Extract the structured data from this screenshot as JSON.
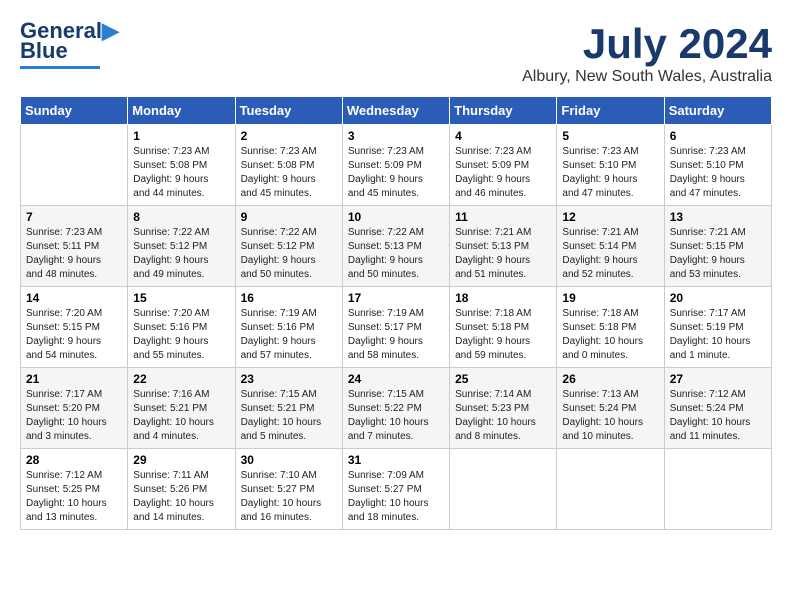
{
  "logo": {
    "line1": "General",
    "line2": "Blue"
  },
  "title": "July 2024",
  "subtitle": "Albury, New South Wales, Australia",
  "days_of_week": [
    "Sunday",
    "Monday",
    "Tuesday",
    "Wednesday",
    "Thursday",
    "Friday",
    "Saturday"
  ],
  "weeks": [
    [
      {
        "num": "",
        "info": ""
      },
      {
        "num": "1",
        "info": "Sunrise: 7:23 AM\nSunset: 5:08 PM\nDaylight: 9 hours\nand 44 minutes."
      },
      {
        "num": "2",
        "info": "Sunrise: 7:23 AM\nSunset: 5:08 PM\nDaylight: 9 hours\nand 45 minutes."
      },
      {
        "num": "3",
        "info": "Sunrise: 7:23 AM\nSunset: 5:09 PM\nDaylight: 9 hours\nand 45 minutes."
      },
      {
        "num": "4",
        "info": "Sunrise: 7:23 AM\nSunset: 5:09 PM\nDaylight: 9 hours\nand 46 minutes."
      },
      {
        "num": "5",
        "info": "Sunrise: 7:23 AM\nSunset: 5:10 PM\nDaylight: 9 hours\nand 47 minutes."
      },
      {
        "num": "6",
        "info": "Sunrise: 7:23 AM\nSunset: 5:10 PM\nDaylight: 9 hours\nand 47 minutes."
      }
    ],
    [
      {
        "num": "7",
        "info": "Sunrise: 7:23 AM\nSunset: 5:11 PM\nDaylight: 9 hours\nand 48 minutes."
      },
      {
        "num": "8",
        "info": "Sunrise: 7:22 AM\nSunset: 5:12 PM\nDaylight: 9 hours\nand 49 minutes."
      },
      {
        "num": "9",
        "info": "Sunrise: 7:22 AM\nSunset: 5:12 PM\nDaylight: 9 hours\nand 50 minutes."
      },
      {
        "num": "10",
        "info": "Sunrise: 7:22 AM\nSunset: 5:13 PM\nDaylight: 9 hours\nand 50 minutes."
      },
      {
        "num": "11",
        "info": "Sunrise: 7:21 AM\nSunset: 5:13 PM\nDaylight: 9 hours\nand 51 minutes."
      },
      {
        "num": "12",
        "info": "Sunrise: 7:21 AM\nSunset: 5:14 PM\nDaylight: 9 hours\nand 52 minutes."
      },
      {
        "num": "13",
        "info": "Sunrise: 7:21 AM\nSunset: 5:15 PM\nDaylight: 9 hours\nand 53 minutes."
      }
    ],
    [
      {
        "num": "14",
        "info": "Sunrise: 7:20 AM\nSunset: 5:15 PM\nDaylight: 9 hours\nand 54 minutes."
      },
      {
        "num": "15",
        "info": "Sunrise: 7:20 AM\nSunset: 5:16 PM\nDaylight: 9 hours\nand 55 minutes."
      },
      {
        "num": "16",
        "info": "Sunrise: 7:19 AM\nSunset: 5:16 PM\nDaylight: 9 hours\nand 57 minutes."
      },
      {
        "num": "17",
        "info": "Sunrise: 7:19 AM\nSunset: 5:17 PM\nDaylight: 9 hours\nand 58 minutes."
      },
      {
        "num": "18",
        "info": "Sunrise: 7:18 AM\nSunset: 5:18 PM\nDaylight: 9 hours\nand 59 minutes."
      },
      {
        "num": "19",
        "info": "Sunrise: 7:18 AM\nSunset: 5:18 PM\nDaylight: 10 hours\nand 0 minutes."
      },
      {
        "num": "20",
        "info": "Sunrise: 7:17 AM\nSunset: 5:19 PM\nDaylight: 10 hours\nand 1 minute."
      }
    ],
    [
      {
        "num": "21",
        "info": "Sunrise: 7:17 AM\nSunset: 5:20 PM\nDaylight: 10 hours\nand 3 minutes."
      },
      {
        "num": "22",
        "info": "Sunrise: 7:16 AM\nSunset: 5:21 PM\nDaylight: 10 hours\nand 4 minutes."
      },
      {
        "num": "23",
        "info": "Sunrise: 7:15 AM\nSunset: 5:21 PM\nDaylight: 10 hours\nand 5 minutes."
      },
      {
        "num": "24",
        "info": "Sunrise: 7:15 AM\nSunset: 5:22 PM\nDaylight: 10 hours\nand 7 minutes."
      },
      {
        "num": "25",
        "info": "Sunrise: 7:14 AM\nSunset: 5:23 PM\nDaylight: 10 hours\nand 8 minutes."
      },
      {
        "num": "26",
        "info": "Sunrise: 7:13 AM\nSunset: 5:24 PM\nDaylight: 10 hours\nand 10 minutes."
      },
      {
        "num": "27",
        "info": "Sunrise: 7:12 AM\nSunset: 5:24 PM\nDaylight: 10 hours\nand 11 minutes."
      }
    ],
    [
      {
        "num": "28",
        "info": "Sunrise: 7:12 AM\nSunset: 5:25 PM\nDaylight: 10 hours\nand 13 minutes."
      },
      {
        "num": "29",
        "info": "Sunrise: 7:11 AM\nSunset: 5:26 PM\nDaylight: 10 hours\nand 14 minutes."
      },
      {
        "num": "30",
        "info": "Sunrise: 7:10 AM\nSunset: 5:27 PM\nDaylight: 10 hours\nand 16 minutes."
      },
      {
        "num": "31",
        "info": "Sunrise: 7:09 AM\nSunset: 5:27 PM\nDaylight: 10 hours\nand 18 minutes."
      },
      {
        "num": "",
        "info": ""
      },
      {
        "num": "",
        "info": ""
      },
      {
        "num": "",
        "info": ""
      }
    ]
  ]
}
